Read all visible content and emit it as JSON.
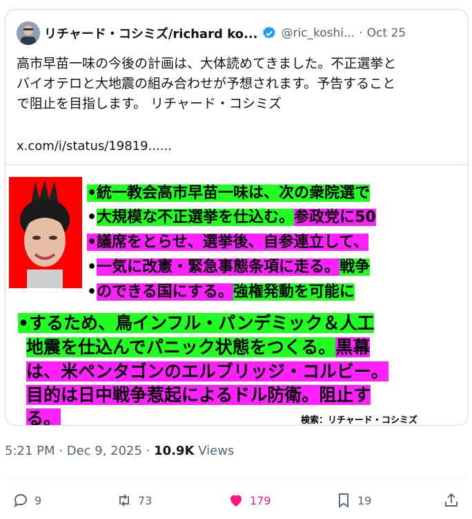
{
  "quoted": {
    "display_name": "リチャード・コシミズ/richard ko...",
    "handle": "@ric_koshi...",
    "separator": "·",
    "date": "Oct 25",
    "text": "高市早苗一味の今後の計画は、大体読めてきました。不正選挙と\nバイオテロと大地震の組み合わせが予想されます。予告すること\nで阻止を目指します。 リチャード・コシミズ",
    "link": "x.com/i/status/19819......"
  },
  "image": {
    "lines": [
      {
        "text": "•統一教会高市早苗一味は、次の衆院選で"
      },
      {
        "parts": [
          "•",
          "大規模な不正選挙を仕込む。",
          "参政党に50"
        ]
      },
      {
        "text": "•議席をとらせ、選挙後、自参連立して、"
      },
      {
        "parts": [
          "•",
          "一気に改憲・緊急事態条項に走る。",
          "戦争"
        ]
      },
      {
        "parts": [
          "•",
          "のできる国にする。",
          "強権発動を可能に"
        ]
      },
      {
        "text": "•するため、鳥インフル・パンデミック＆人工"
      },
      {
        "parts": [
          "地震を仕込んでパニック状態をつくる。",
          "黒幕"
        ]
      },
      {
        "text": "は、米ペンタゴンのエルブリッジ・コルビー。"
      },
      {
        "text": "目的は日中戦争惹起によるドル防衛。阻止す"
      },
      {
        "text": "る。"
      }
    ],
    "search_caption": "検索：リチャード・コシミズ"
  },
  "meta": {
    "time": "5:21 PM",
    "sep1": " · ",
    "date": "Dec 9, 2025",
    "sep2": " · ",
    "views": "10.9K",
    "views_label": " Views"
  },
  "actions": {
    "replies": "9",
    "reposts": "73",
    "likes": "179",
    "bookmarks": "19"
  },
  "colors": {
    "highlight_green": "#22ff22",
    "highlight_magenta": "#ff22ff",
    "like_pink": "#f91880",
    "verified_blue": "#1d9bf0",
    "muted": "#536471"
  }
}
